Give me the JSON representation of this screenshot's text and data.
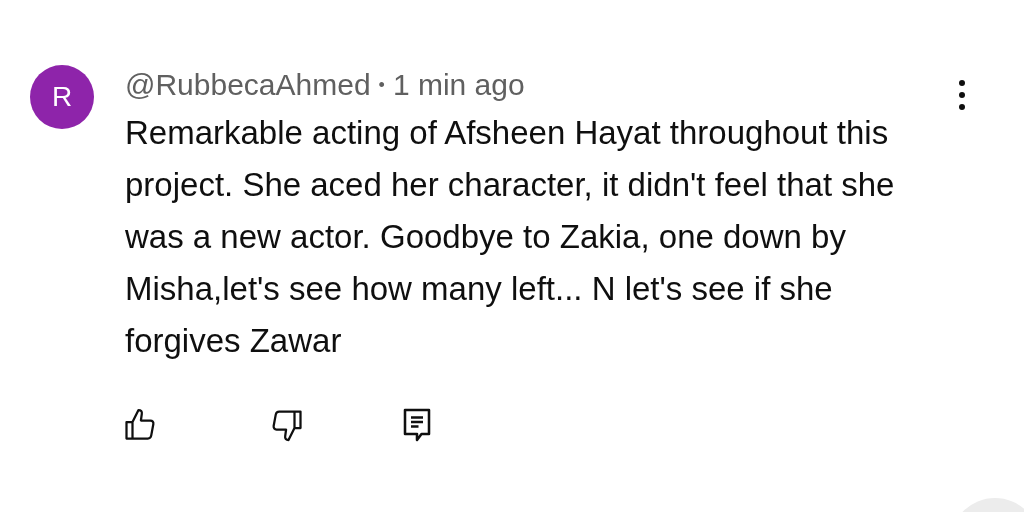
{
  "comment": {
    "avatar": {
      "letter": "R",
      "color": "#8e24aa"
    },
    "author": "@RubbecaAhmed",
    "separator": "•",
    "time": "1 min ago",
    "text": "Remarkable acting of Afsheen Hayat throughout this project. She aced her character, it didn't feel that she was a new actor. Goodbye to Zakia, one down by Misha,let's see how many left... N let's see if she forgives Zawar"
  }
}
